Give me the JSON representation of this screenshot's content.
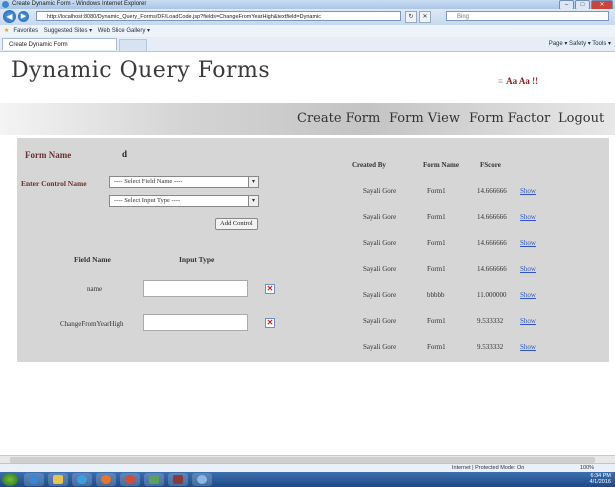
{
  "browser": {
    "window_title": "Create Dynamic Form - Windows Internet Explorer",
    "address": "http://localhost:8080/Dynamic_Query_Forms/DF/LoadCode.jsp?fields=ChangeFromYearHigh&textfield=Dynamic",
    "search_placeholder": "Bing",
    "favorites_label": "Favorites",
    "suggested_sites": "Suggested Sites ▾",
    "web_slice": "Web Slice Gallery ▾",
    "tab_title": "Create Dynamic Form",
    "command_bar": "Page ▾  Safety ▾  Tools ▾"
  },
  "header": {
    "brand": "Dynamic Query Forms",
    "font_size_controls": "Aa Aa !!"
  },
  "menu": {
    "create_form": "Create Form",
    "form_view": "Form View",
    "form_factor": "Form Factor",
    "logout": "Logout"
  },
  "form": {
    "form_name_label": "Form Name",
    "form_name_value": "d",
    "enter_control_label": "Enter Control Name",
    "field_select": "---- Select Field Name ----",
    "input_type_select": "---- Select Input Type ----",
    "add_control": "Add Control",
    "col_field_name": "Field Name",
    "col_input_type": "Input Type",
    "rows": [
      {
        "field": "name"
      },
      {
        "field": "ChangeFromYearHigh"
      }
    ]
  },
  "table": {
    "headers": [
      "Created By",
      "Form Name",
      "FScore",
      ""
    ],
    "rows": [
      {
        "created_by": "Sayali Gore",
        "form_name": "Form1",
        "fscore": "14.666666",
        "action": "Show"
      },
      {
        "created_by": "Sayali Gore",
        "form_name": "Form1",
        "fscore": "14.666666",
        "action": "Show"
      },
      {
        "created_by": "Sayali Gore",
        "form_name": "Form1",
        "fscore": "14.666666",
        "action": "Show"
      },
      {
        "created_by": "Sayali Gore",
        "form_name": "Form1",
        "fscore": "14.666666",
        "action": "Show"
      },
      {
        "created_by": "Sayali Gore",
        "form_name": "bbbbb",
        "fscore": "11.000000",
        "action": "Show"
      },
      {
        "created_by": "Sayali Gore",
        "form_name": "Form1",
        "fscore": "9.533332",
        "action": "Show"
      },
      {
        "created_by": "Sayali Gore",
        "form_name": "Form1",
        "fscore": "9.533332",
        "action": "Show"
      }
    ]
  },
  "statusbar": {
    "zone": "Internet | Protected Mode: On",
    "zoom": "100%"
  },
  "taskbar": {
    "time": "6:34 PM",
    "date": "4/1/2016"
  }
}
